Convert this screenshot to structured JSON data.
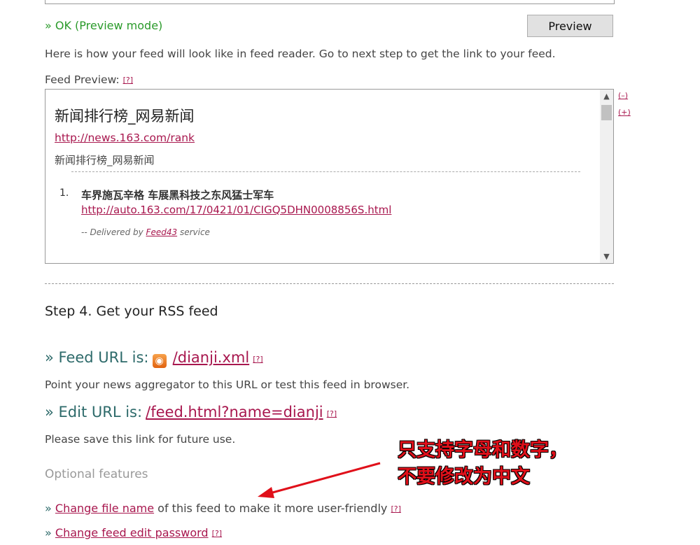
{
  "status": {
    "ok_text": "» OK (Preview mode)"
  },
  "toolbar": {
    "preview_label": "Preview"
  },
  "intro_text": "Here is how your feed will look like in feed reader. Go to next step to get the link to your feed.",
  "feed_preview": {
    "label": "Feed Preview:",
    "help": "[?]",
    "title": "新闻排行榜_网易新闻",
    "link": "http://news.163.com/rank",
    "description": "新闻排行榜_网易新闻",
    "item_number": "1.",
    "item_title": "车界施瓦辛格 车展黑科技之东风猛士军车",
    "item_link": "http://auto.163.com/17/0421/01/CIGQ5DHN0008856S.html",
    "delivered_prefix": "-- Delivered by",
    "delivered_link": "Feed43",
    "delivered_suffix": "service",
    "zoom_out": "(–)",
    "zoom_in": "(+)"
  },
  "step4": {
    "title": "Step 4. Get your RSS feed",
    "feed_url_label": "» Feed URL is:",
    "feed_url": "/dianji.xml",
    "feed_url_help": "[?]",
    "feed_url_note": "Point your news aggregator to this URL or test this feed in browser.",
    "edit_url_label": "» Edit URL is:",
    "edit_url": "/feed.html?name=dianji",
    "edit_url_help": "[?]",
    "edit_url_note": "Please save this link for future use."
  },
  "optional": {
    "heading": "Optional features",
    "change_name_prefix": "»",
    "change_name_link": "Change file name",
    "change_name_suffix": "of this feed to make it more user-friendly",
    "change_name_help": "[?]",
    "change_pw_prefix": "»",
    "change_pw_link": "Change feed edit password",
    "change_pw_help": "[?]"
  },
  "annotation": {
    "line1": "只支持字母和数字，",
    "line2": "不要修改为中文",
    "color": "#e0101a"
  }
}
